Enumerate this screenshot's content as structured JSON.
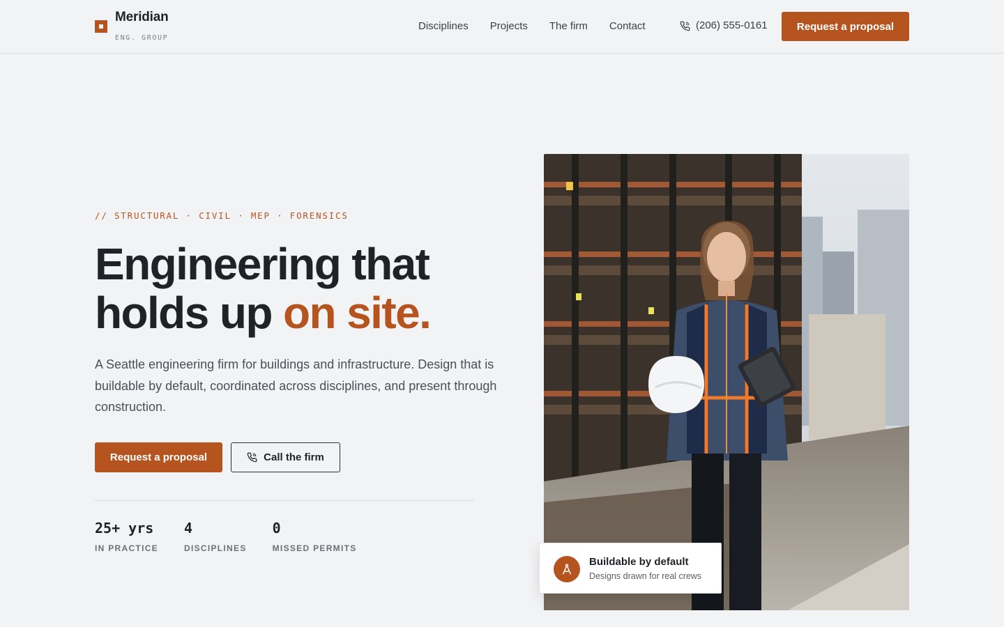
{
  "brand": {
    "name": "Meridian",
    "tagline": "ENG. GROUP"
  },
  "nav": {
    "items": [
      {
        "label": "Disciplines"
      },
      {
        "label": "Projects"
      },
      {
        "label": "The firm"
      },
      {
        "label": "Contact"
      }
    ],
    "phone": "(206) 555-0161",
    "cta_label": "Request a proposal"
  },
  "hero": {
    "eyebrow": "// STRUCTURAL · CIVIL · MEP · FORENSICS",
    "headline_line1": "Engineering that",
    "headline_line2_plain": "holds up ",
    "headline_line2_accent": "on site.",
    "lede": "A Seattle engineering firm for buildings and infrastructure. Design that is buildable by default, coordinated across disciplines, and present through construction.",
    "primary_cta": "Request a proposal",
    "secondary_cta": "Call the firm",
    "stats": [
      {
        "value": "25+ yrs",
        "label": "IN PRACTICE"
      },
      {
        "value": "4",
        "label": "DISCIPLINES"
      },
      {
        "value": "0",
        "label": "MISSED PERMITS"
      }
    ]
  },
  "photo_badge": {
    "title": "Buildable by default",
    "subtitle": "Designs drawn for real crews",
    "icon": "compass-icon"
  },
  "colors": {
    "accent": "#b5541e",
    "background": "#f2f3f5",
    "text": "#1f2328"
  }
}
